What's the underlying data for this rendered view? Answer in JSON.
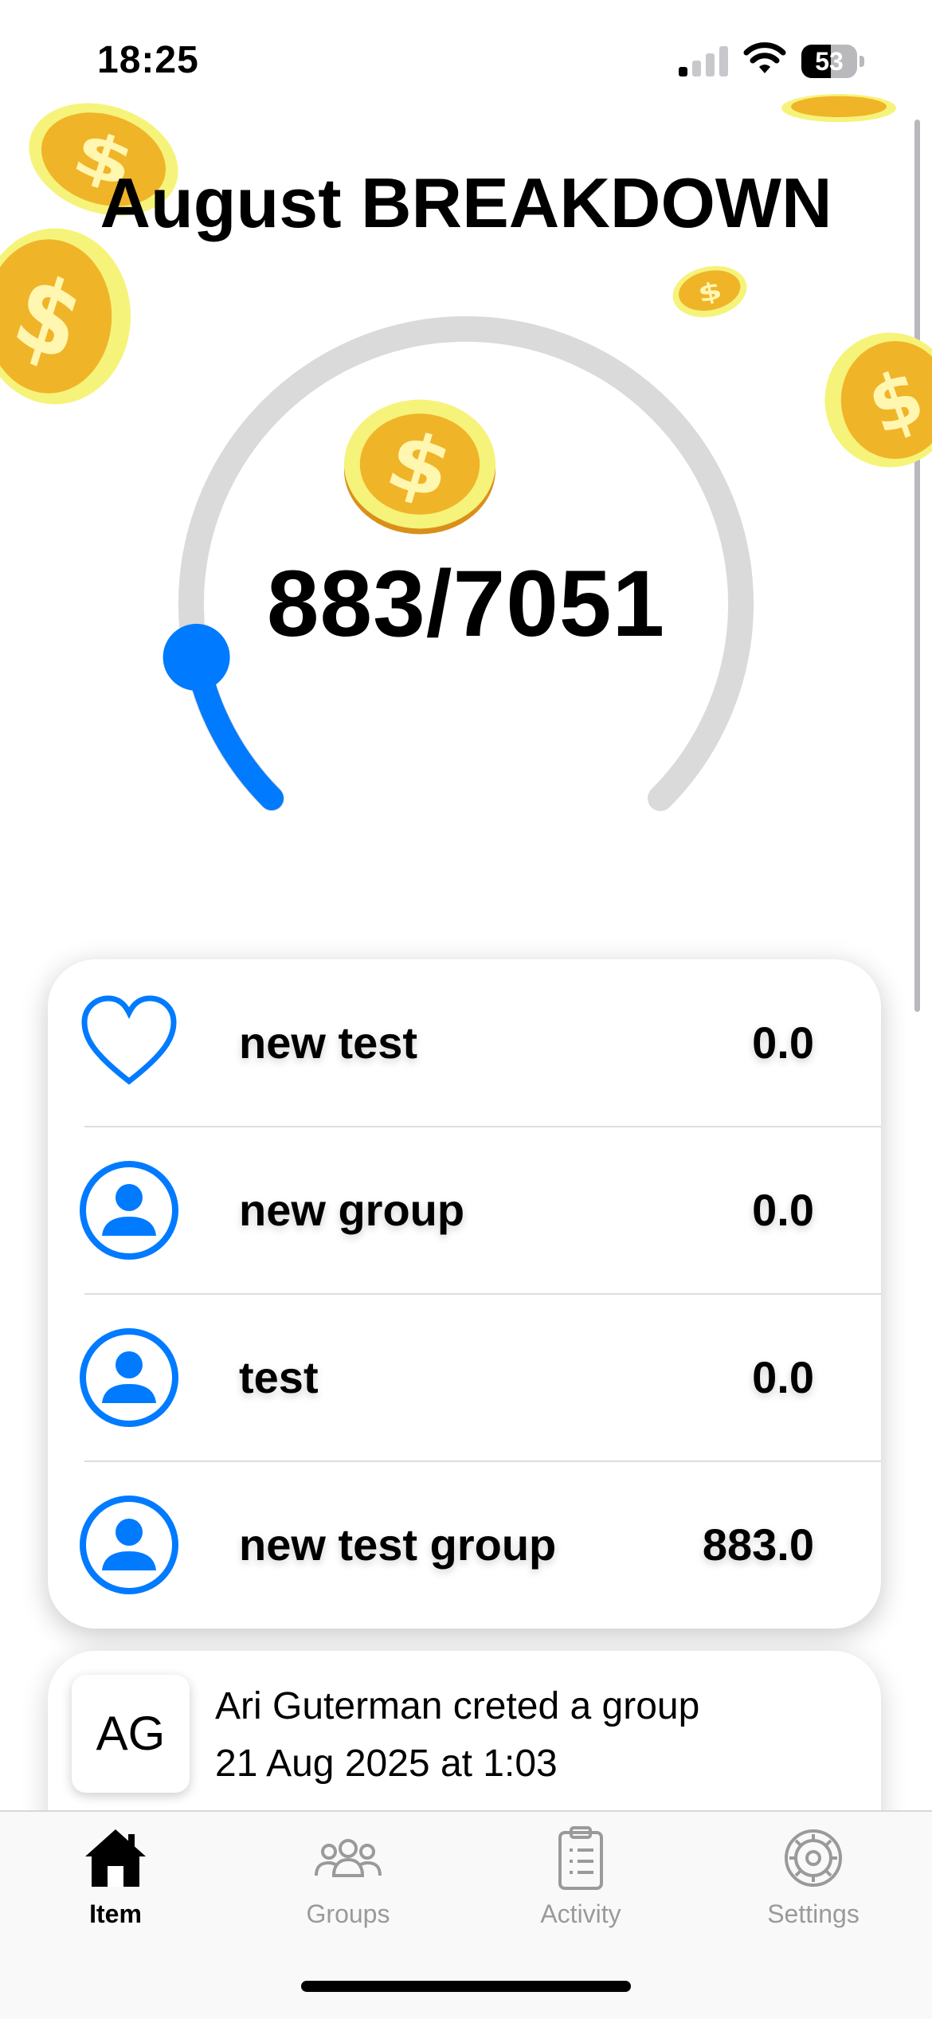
{
  "status_bar": {
    "time": "18:25",
    "battery_level": "53"
  },
  "page": {
    "title": "August BREAKDOWN"
  },
  "budget": {
    "spent": 883,
    "total": 7051,
    "display": "883/7051",
    "accent_color": "#007AFF",
    "track_color": "#DADADA"
  },
  "groups": [
    {
      "icon": "heart-icon",
      "name": "new test",
      "amount": "0.0"
    },
    {
      "icon": "person-circle-icon",
      "name": "new group",
      "amount": "0.0"
    },
    {
      "icon": "person-circle-icon",
      "name": "test",
      "amount": "0.0"
    },
    {
      "icon": "person-circle-icon",
      "name": "new test group",
      "amount": "883.0"
    }
  ],
  "activity": {
    "avatar_initials": "AG",
    "text": "Ari Guterman creted a group",
    "time": "21 Aug 2025 at 1:03"
  },
  "tab_bar": {
    "tabs": [
      {
        "icon": "house-icon",
        "label": "Item",
        "active": true
      },
      {
        "icon": "people-icon",
        "label": "Groups",
        "active": false
      },
      {
        "icon": "clipboard-icon",
        "label": "Activity",
        "active": false
      },
      {
        "icon": "gear-icon",
        "label": "Settings",
        "active": false
      }
    ]
  }
}
